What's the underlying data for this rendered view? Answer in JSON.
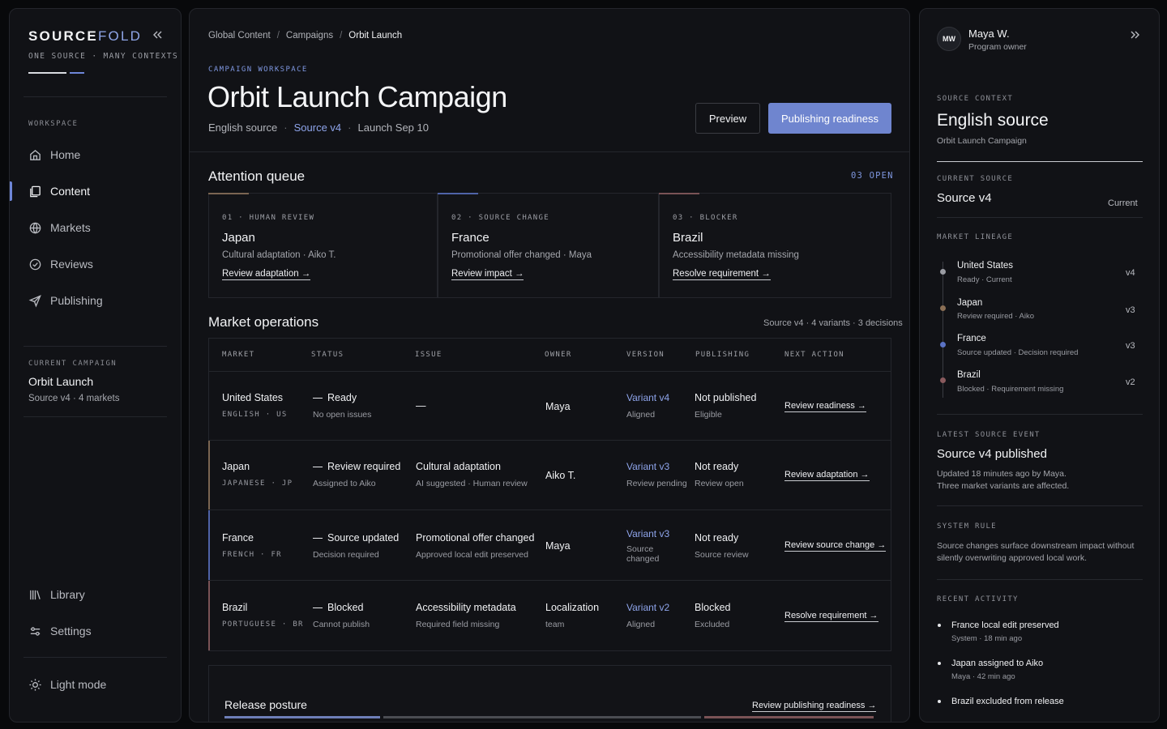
{
  "sidebar": {
    "brand_a": "SOURCE",
    "brand_b": "FOLD",
    "tagline": "ONE SOURCE · MANY CONTEXTS",
    "workspace_caption": "WORKSPACE",
    "nav": [
      {
        "label": "Home",
        "icon": "home-icon"
      },
      {
        "label": "Content",
        "icon": "content-icon",
        "active": true
      },
      {
        "label": "Markets",
        "icon": "globe-icon"
      },
      {
        "label": "Reviews",
        "icon": "check-circle-icon"
      },
      {
        "label": "Publishing",
        "icon": "send-icon"
      }
    ],
    "current_campaign_caption": "CURRENT CAMPAIGN",
    "current_campaign_name": "Orbit Launch",
    "current_campaign_meta": "Source v4 · 4 markets",
    "bottom_nav": [
      {
        "label": "Library",
        "icon": "library-icon"
      },
      {
        "label": "Settings",
        "icon": "sliders-icon"
      }
    ],
    "theme_toggle": "Light mode"
  },
  "main": {
    "breadcrumb": [
      "Global Content",
      "Campaigns",
      "Orbit Launch"
    ],
    "eyebrow": "CAMPAIGN WORKSPACE",
    "title": "Orbit Launch Campaign",
    "meta": {
      "source": "English source",
      "version": "Source v4",
      "launch": "Launch Sep 10"
    },
    "preview_label": "Preview",
    "primary_label": "Publishing readiness",
    "attention": {
      "title": "Attention queue",
      "count": "03 OPEN",
      "cards": [
        {
          "tag": "01 · HUMAN REVIEW",
          "title": "Japan",
          "desc": "Cultural adaptation · Aiko T.",
          "link": "Review adaptation →",
          "color": "#7b6552"
        },
        {
          "tag": "02 · SOURCE CHANGE",
          "title": "France",
          "desc": "Promotional offer changed · Maya",
          "link": "Review impact →",
          "color": "#4f63a8"
        },
        {
          "tag": "03 · BLOCKER",
          "title": "Brazil",
          "desc": "Accessibility metadata missing",
          "link": "Resolve requirement →",
          "color": "#7a5356"
        }
      ]
    },
    "operations": {
      "title": "Market operations",
      "meta": "Source v4 · 4 variants · 3 decisions",
      "headers": [
        "MARKET",
        "STATUS",
        "ISSUE",
        "OWNER",
        "VERSION",
        "PUBLISHING",
        "NEXT ACTION"
      ],
      "rows": [
        {
          "market": "United States",
          "code": "ENGLISH · US",
          "status": "Ready",
          "status_sub": "No open issues",
          "issue": "—",
          "issue_sub": "",
          "owner": "Maya",
          "owner_sub": "",
          "version": "Variant v4",
          "version_sub": "Aligned",
          "publishing": "Not published",
          "publishing_sub": "Eligible",
          "action": "Review readiness →"
        },
        {
          "market": "Japan",
          "code": "JAPANESE · JP",
          "status": "Review required",
          "status_sub": "Assigned to Aiko",
          "issue": "Cultural adaptation",
          "issue_sub": "AI suggested · Human review",
          "owner": "Aiko T.",
          "owner_sub": "",
          "version": "Variant v3",
          "version_sub": "Review pending",
          "publishing": "Not ready",
          "publishing_sub": "Review open",
          "action": "Review adaptation →"
        },
        {
          "market": "France",
          "code": "FRENCH · FR",
          "status": "Source updated",
          "status_sub": "Decision required",
          "issue": "Promotional offer changed",
          "issue_sub": "Approved local edit preserved",
          "owner": "Maya",
          "owner_sub": "",
          "version": "Variant v3",
          "version_sub": "Source changed",
          "publishing": "Not ready",
          "publishing_sub": "Source review",
          "action": "Review source change →"
        },
        {
          "market": "Brazil",
          "code": "PORTUGUESE · BR",
          "status": "Blocked",
          "status_sub": "Cannot publish",
          "issue": "Accessibility metadata",
          "issue_sub": "Required field missing",
          "owner": "Localization",
          "owner_sub": "team",
          "version": "Variant v2",
          "version_sub": "Aligned",
          "publishing": "Blocked",
          "publishing_sub": "Excluded",
          "action": "Resolve requirement →"
        }
      ]
    },
    "release": {
      "title": "Release posture",
      "link": "Review publishing readiness →"
    }
  },
  "right": {
    "avatar": "MW",
    "user_name": "Maya W.",
    "user_role": "Program owner",
    "source_context_caption": "SOURCE CONTEXT",
    "source_context_title": "English source",
    "source_context_sub": "Orbit Launch Campaign",
    "current_source_caption": "CURRENT SOURCE",
    "current_source": "Source v4",
    "current_tag": "Current",
    "lineage_caption": "MARKET LINEAGE",
    "lineage": [
      {
        "name": "United States",
        "sub": "Ready · Current",
        "version": "v4",
        "color": "#9a9ca3"
      },
      {
        "name": "Japan",
        "sub": "Review required · Aiko",
        "version": "v3",
        "color": "#8a6f55"
      },
      {
        "name": "France",
        "sub": "Source updated · Decision required",
        "version": "v3",
        "color": "#5a72c4"
      },
      {
        "name": "Brazil",
        "sub": "Blocked · Requirement missing",
        "version": "v2",
        "color": "#8a5a5d"
      }
    ],
    "latest_event_caption": "LATEST SOURCE EVENT",
    "latest_event_title": "Source v4 published",
    "latest_event_line1": "Updated 18 minutes ago by Maya.",
    "latest_event_line2": "Three market variants are affected.",
    "system_rule_caption": "SYSTEM RULE",
    "system_rule_line1": "Source changes surface downstream impact without",
    "system_rule_line2": "silently overwriting approved local work.",
    "activity_caption": "RECENT ACTIVITY",
    "activity": [
      {
        "title": "France local edit preserved",
        "sub": "System · 18 min ago"
      },
      {
        "title": "Japan assigned to Aiko",
        "sub": "Maya · 42 min ago"
      },
      {
        "title": "Brazil excluded from release",
        "sub": ""
      }
    ]
  }
}
